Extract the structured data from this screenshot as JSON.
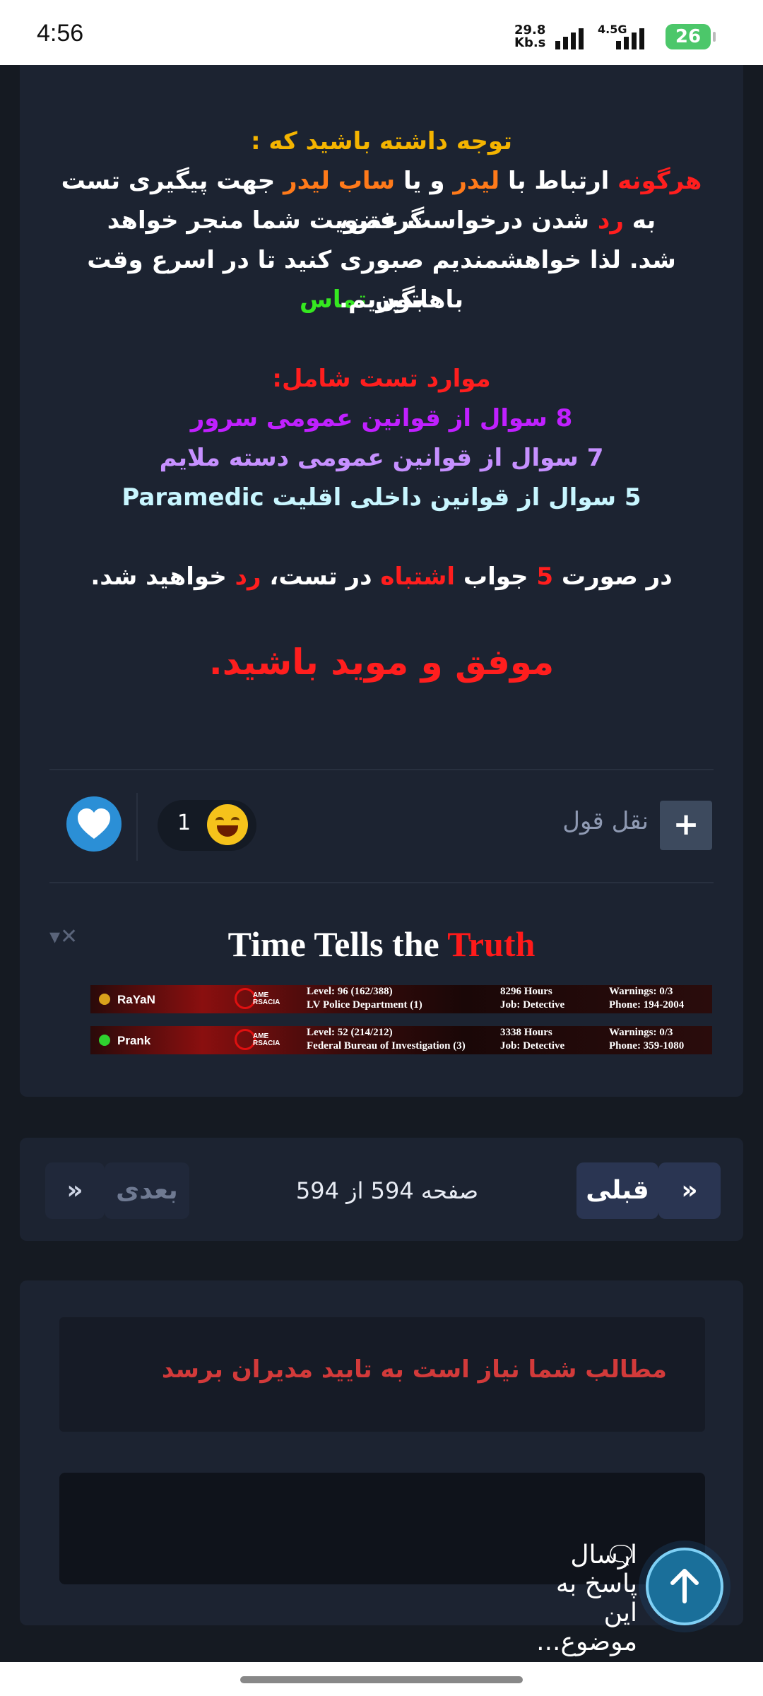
{
  "status_bar": {
    "time": "4:56",
    "speed_value": "29.8",
    "speed_unit": "Kb.s",
    "network": "4.5G",
    "battery": "26"
  },
  "post": {
    "notice_heading": "توجه داشته باشید که :",
    "l2": {
      "a": "هرگونه",
      "b": " ارتباط با ",
      "c": "لیدر",
      "d": " و یا ",
      "e": "ساب لیدر",
      "f": " جهت پیگیری تست گرفتن،"
    },
    "l3": {
      "a": "به ",
      "b": "رد",
      "c": " شدن درخواست عضویت شما منجر خواهد"
    },
    "l4": {
      "a": "شد. لذا خواهشمندیم صبوری کنید تا در اسرع وقت باهاتون ",
      "b": "تماس"
    },
    "l5": "بگیریم.",
    "test_heading": "موارد تست شامل:",
    "test_items": [
      "8 سوال از قوانین عمومی سرور",
      "7 سوال از قوانین عمومی دسته ملایم",
      "5 سوال از قوانین داخلی اقلیت Paramedic"
    ],
    "fail_rule": {
      "a": "در صورت ",
      "b": "5",
      "c": " جواب ",
      "d": "اشتباه",
      "e": " در تست، ",
      "f": "رد",
      "g": " خواهید شد."
    },
    "closing": "موفق و موید باشید.",
    "quote_label": "نقل قول",
    "reaction_count": "1",
    "colors": {
      "accent_red": "#ff1e1e",
      "accent_yellow": "#f4b400",
      "accent_orange": "#ff7a1a",
      "accent_green": "#35e820"
    }
  },
  "signature": {
    "title_a": "Time Tells the ",
    "title_b": "Truth",
    "banners": [
      {
        "name": "RaYaN",
        "level": "Level: 96 (162/388)",
        "dept": "LV Police Department (1)",
        "hours": "8296 Hours",
        "job": "Job: Detective",
        "warnings": "Warnings: 0/3",
        "phone": "Phone: 194-2004",
        "dot_color": "#d9a21b"
      },
      {
        "name": "Prank",
        "level": "Level: 52 (214/212)",
        "dept": "Federal Bureau of Investigation (3)",
        "hours": "3338 Hours",
        "job": "Job: Detective",
        "warnings": "Warnings: 0/3",
        "phone": "Phone: 359-1080",
        "dot_color": "#2fd12f"
      }
    ],
    "logo_text_a": "AME",
    "logo_text_b": "RSACIA"
  },
  "pagination": {
    "prev_label": "قبلی",
    "next_label": "بعدی",
    "first_icon": "»",
    "last_icon": "»",
    "page_info": "صفحه 594 از 594"
  },
  "reply_area": {
    "moderation_notice": "مطالب شما نیاز است به تایید مدیران برسد",
    "reply_placeholder": "ارسال پاسخ به این موضوع..."
  }
}
